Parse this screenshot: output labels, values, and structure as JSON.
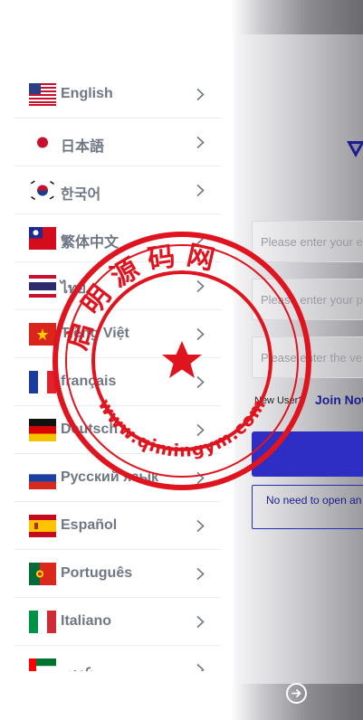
{
  "login": {
    "username_placeholder": "Please enter your e",
    "password_placeholder": "Please enter your p",
    "code_placeholder": "Please enter the ve",
    "new_user_label": "New User?",
    "join_label": "Join Now",
    "note_text": "No need to open an"
  },
  "languages": [
    {
      "label": "English",
      "flag": "us-flag-icon"
    },
    {
      "label": "日本語",
      "flag": "japan-flag-icon"
    },
    {
      "label": "한국어",
      "flag": "korea-flag-icon"
    },
    {
      "label": "繁体中文",
      "flag": "taiwan-flag-icon"
    },
    {
      "label": "ไทย",
      "flag": "thailand-flag-icon"
    },
    {
      "label": "Tiếng Việt",
      "flag": "vietnam-flag-icon"
    },
    {
      "label": "français",
      "flag": "france-flag-icon"
    },
    {
      "label": "Deutsch",
      "flag": "germany-flag-icon"
    },
    {
      "label": "Русский язык",
      "flag": "russia-flag-icon"
    },
    {
      "label": "Español",
      "flag": "spain-flag-icon"
    },
    {
      "label": "Português",
      "flag": "portugal-flag-icon"
    },
    {
      "label": "Italiano",
      "flag": "italy-flag-icon"
    },
    {
      "label": "عربي",
      "flag": "uae-flag-icon"
    }
  ],
  "stamp": {
    "top_text": "启明源码网",
    "bottom_text": "www.qimingym.com",
    "color": "#e0141e"
  }
}
